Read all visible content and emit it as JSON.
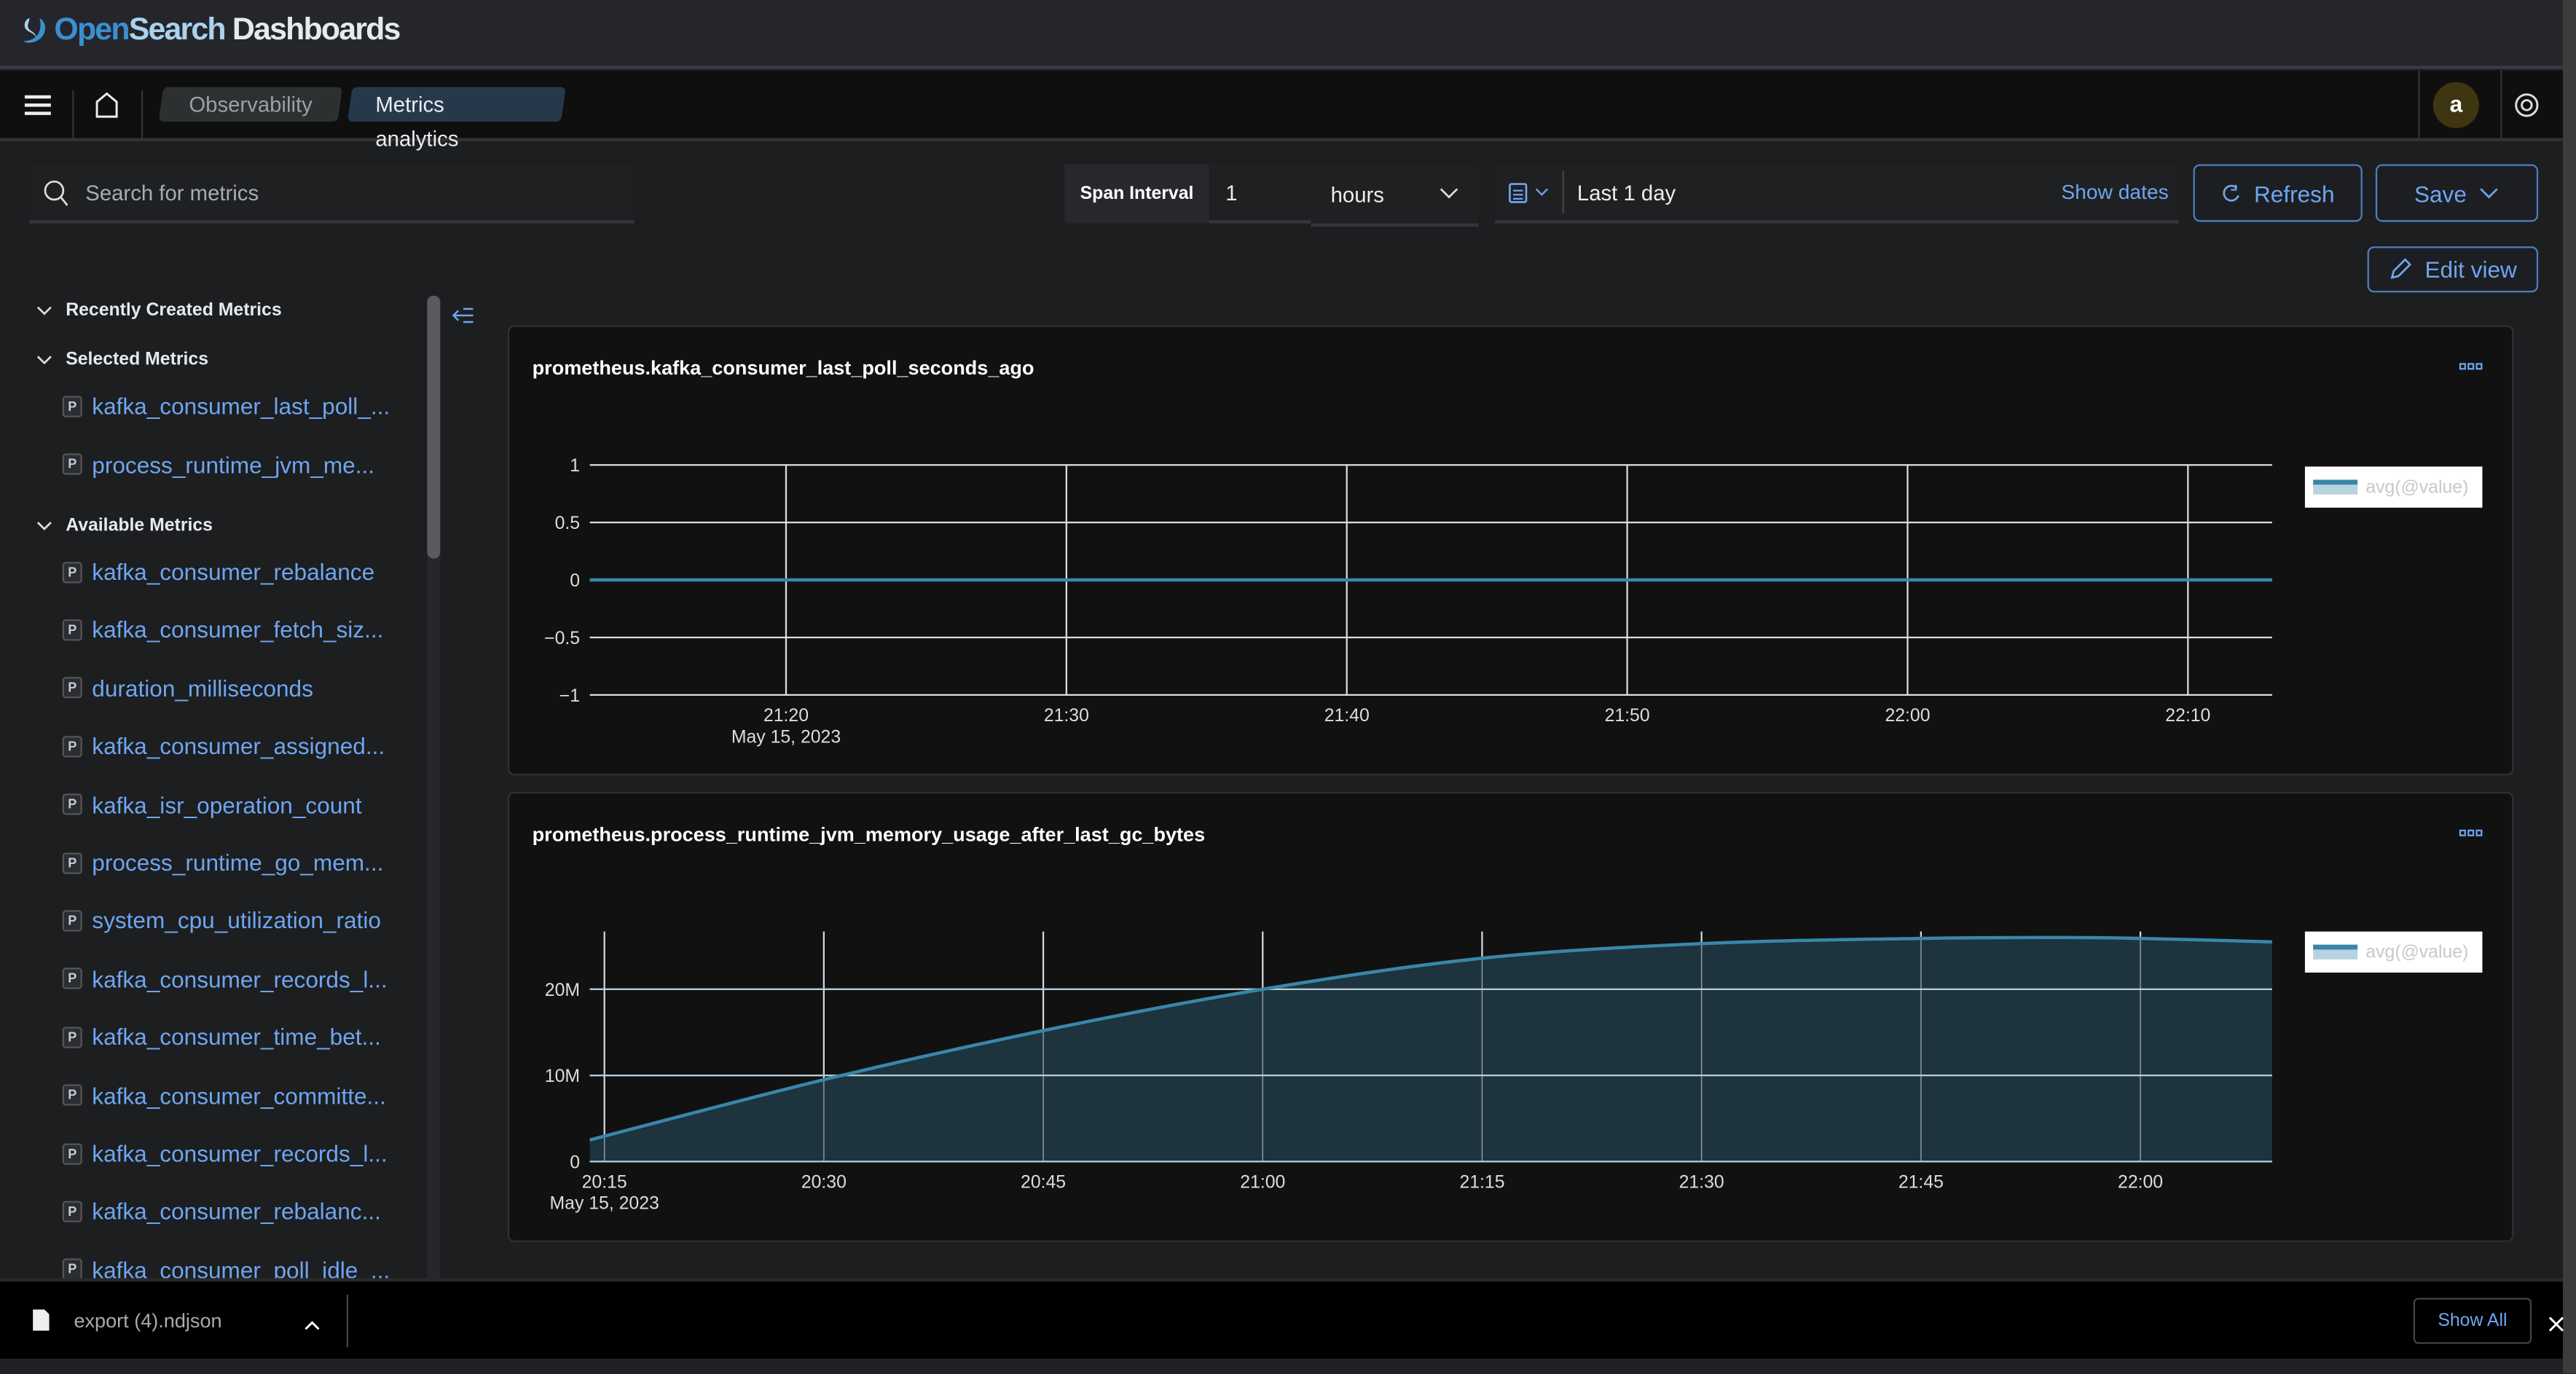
{
  "header": {
    "logo": {
      "open": "Open",
      "search": "Search",
      "dash": "Dashboards"
    }
  },
  "nav": {
    "breadcrumbs": [
      "Observability",
      "Metrics analytics"
    ],
    "avatar": "a"
  },
  "toolbar": {
    "search_placeholder": "Search for metrics",
    "span_label": "Span Interval",
    "span_value": "1",
    "span_unit": "hours",
    "date_range": "Last 1 day",
    "show_dates": "Show dates",
    "refresh": "Refresh",
    "save": "Save",
    "edit_view": "Edit view"
  },
  "sidebar": {
    "recent_header": "Recently Created Metrics",
    "selected_header": "Selected Metrics",
    "available_header": "Available Metrics",
    "badge": "P",
    "selected": [
      "kafka_consumer_last_poll_...",
      "process_runtime_jvm_me..."
    ],
    "available": [
      "kafka_consumer_rebalance",
      "kafka_consumer_fetch_siz...",
      "duration_milliseconds",
      "kafka_consumer_assigned...",
      "kafka_isr_operation_count",
      "process_runtime_go_mem...",
      "system_cpu_utilization_ratio",
      "kafka_consumer_records_l...",
      "kafka_consumer_time_bet...",
      "kafka_consumer_committe...",
      "kafka_consumer_records_l...",
      "kafka_consumer_rebalanc...",
      "kafka_consumer_poll_idle_..."
    ]
  },
  "downloads": {
    "file": "export (4).ndjson",
    "show_all": "Show All"
  },
  "colors": {
    "accent": "#6ea6f0",
    "series": "#3a86a8",
    "area": "#1f3744"
  },
  "chart_data": [
    {
      "type": "line",
      "title": "prometheus.kafka_consumer_last_poll_seconds_ago",
      "date_label": "May 15, 2023",
      "legend": "avg(@value)",
      "legend_placement": "right",
      "grid": true,
      "x": [
        "21:13",
        "21:20",
        "21:30",
        "21:40",
        "21:50",
        "22:00",
        "22:10",
        "22:13"
      ],
      "y": [
        0,
        0,
        0,
        0,
        0,
        0,
        0,
        0
      ],
      "xlim": [
        "21:13",
        "22:13"
      ],
      "ylim": [
        -1,
        1
      ],
      "xticks": [
        "21:20",
        "21:30",
        "21:40",
        "21:50",
        "22:00",
        "22:10"
      ],
      "yticks": [
        {
          "v": 1,
          "l": "1"
        },
        {
          "v": 0.5,
          "l": "0.5"
        },
        {
          "v": 0,
          "l": "0"
        },
        {
          "v": -0.5,
          "l": "−0.5"
        },
        {
          "v": -1,
          "l": "−1"
        }
      ]
    },
    {
      "type": "area",
      "title": "prometheus.process_runtime_jvm_memory_usage_after_last_gc_bytes",
      "date_label": "May 15, 2023",
      "legend": "avg(@value)",
      "legend_placement": "right",
      "grid": true,
      "x": [
        "20:14",
        "20:30",
        "20:45",
        "21:00",
        "21:15",
        "21:30",
        "21:45",
        "21:55",
        "22:00",
        "22:09"
      ],
      "y": [
        2500000,
        9500000,
        15200000,
        20000000,
        23600000,
        25300000,
        25900000,
        26000000,
        25900000,
        25500000
      ],
      "xlim": [
        "20:14",
        "22:09"
      ],
      "ylim": [
        0,
        26700000
      ],
      "xticks": [
        "20:15",
        "20:30",
        "20:45",
        "21:00",
        "21:15",
        "21:30",
        "21:45",
        "22:00"
      ],
      "yticks": [
        {
          "v": 0,
          "l": "0"
        },
        {
          "v": 10000000,
          "l": "10M"
        },
        {
          "v": 20000000,
          "l": "20M"
        }
      ]
    }
  ]
}
